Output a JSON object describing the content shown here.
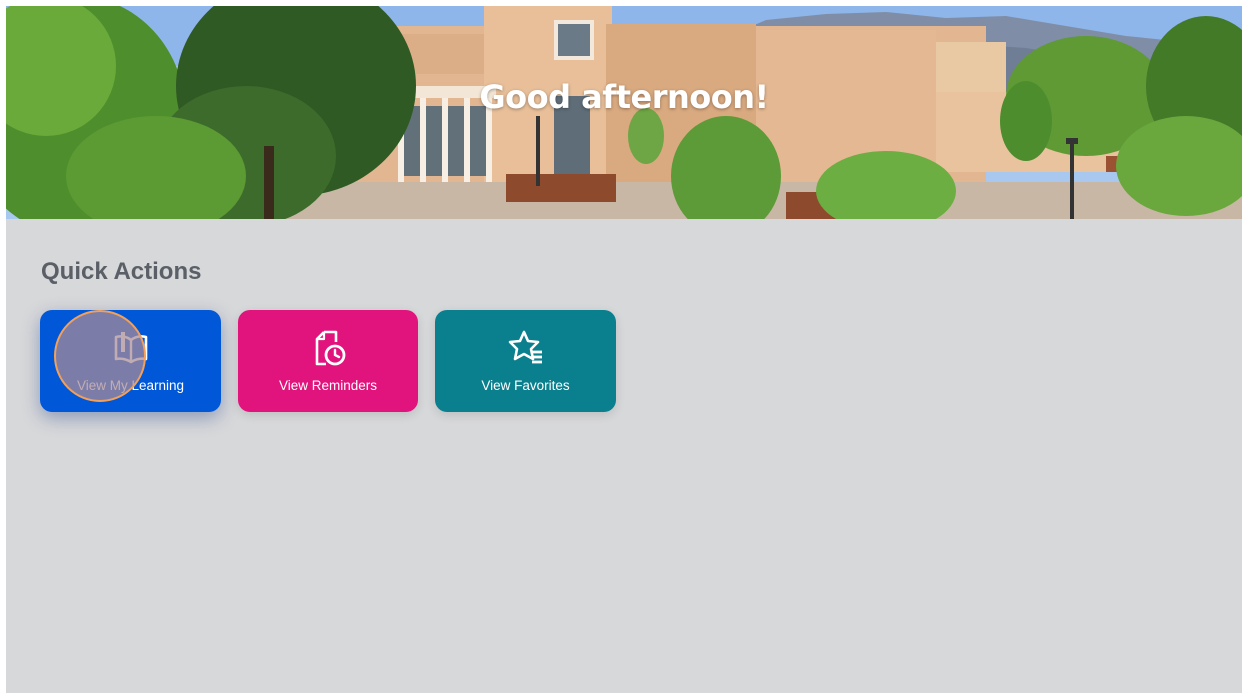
{
  "hero": {
    "greeting": "Good afternoon!"
  },
  "quick_actions": {
    "title": "Quick Actions",
    "tiles": [
      {
        "label": "View My Learning",
        "icon": "open-book-icon",
        "color": "#0057d8"
      },
      {
        "label": "View Reminders",
        "icon": "document-clock-icon",
        "color": "#e0147c"
      },
      {
        "label": "View Favorites",
        "icon": "star-list-icon",
        "color": "#0a7f8e"
      }
    ]
  },
  "cursor": {
    "highlight_color": "#f2a05a"
  }
}
